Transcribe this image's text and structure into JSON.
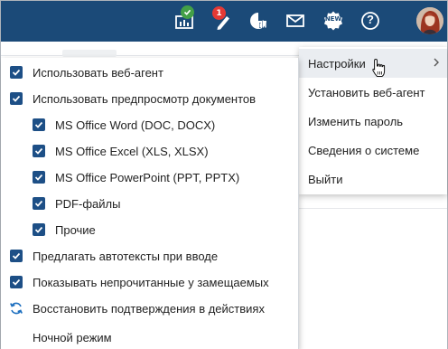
{
  "toolbar": {
    "icons": [
      {
        "name": "presentation-board-icon",
        "badge_color": "#43a047"
      },
      {
        "name": "edit-pencil-icon",
        "badge": "1",
        "badge_color": "#e53935"
      },
      {
        "name": "analytics-pie-icon"
      },
      {
        "name": "mail-envelope-icon"
      },
      {
        "name": "new-badge-icon",
        "label": "NEW"
      },
      {
        "name": "help-circle-icon",
        "label": "?"
      },
      {
        "name": "user-avatar"
      }
    ],
    "background_color": "#1b4a78"
  },
  "account_menu": {
    "items": [
      {
        "label": "Настройки",
        "active": true,
        "has_submenu": true
      },
      {
        "label": "Установить веб-агент"
      },
      {
        "label": "Изменить пароль"
      },
      {
        "label": "Сведения о системе"
      },
      {
        "label": "Выйти"
      }
    ]
  },
  "settings_menu": {
    "options": [
      {
        "label": "Использовать веб-агент",
        "checked": true,
        "indent": 0
      },
      {
        "label": "Использовать предпросмотр документов",
        "checked": true,
        "indent": 0
      },
      {
        "label": "MS Office Word (DOC, DOCX)",
        "checked": true,
        "indent": 1
      },
      {
        "label": "MS Office Excel (XLS, XLSX)",
        "checked": true,
        "indent": 1
      },
      {
        "label": "MS Office PowerPoint (PPT, PPTX)",
        "checked": true,
        "indent": 1
      },
      {
        "label": "PDF-файлы",
        "checked": true,
        "indent": 1
      },
      {
        "label": "Прочие",
        "checked": true,
        "indent": 1
      },
      {
        "label": "Предлагать автотексты при вводе",
        "checked": true,
        "indent": 0
      },
      {
        "label": "Показывать непрочитанные у замещаемых",
        "checked": true,
        "indent": 0
      },
      {
        "label": "Восстановить подтверждения в действиях",
        "icon": "refresh-icon",
        "indent": 0
      },
      {
        "label": "Ночной режим",
        "indent": 0
      }
    ],
    "accent_color": "#1d4f86"
  }
}
